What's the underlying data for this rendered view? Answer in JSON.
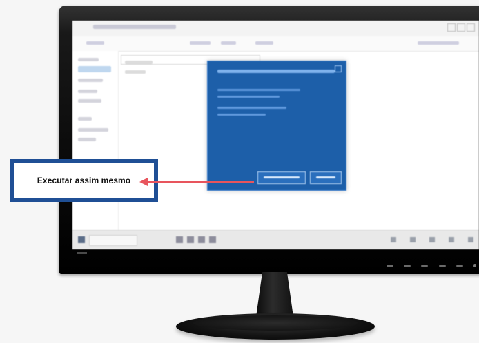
{
  "callout": {
    "label": "Executar assim mesmo",
    "border_color": "#1f4f95",
    "arrow_color": "#e8555d"
  },
  "dialog": {
    "background_color": "#1d5fa9",
    "buttons": [
      "primary-button",
      "secondary-button"
    ]
  },
  "device": {
    "type": "desktop-monitor",
    "bezel_color": "#0b0b0b"
  }
}
